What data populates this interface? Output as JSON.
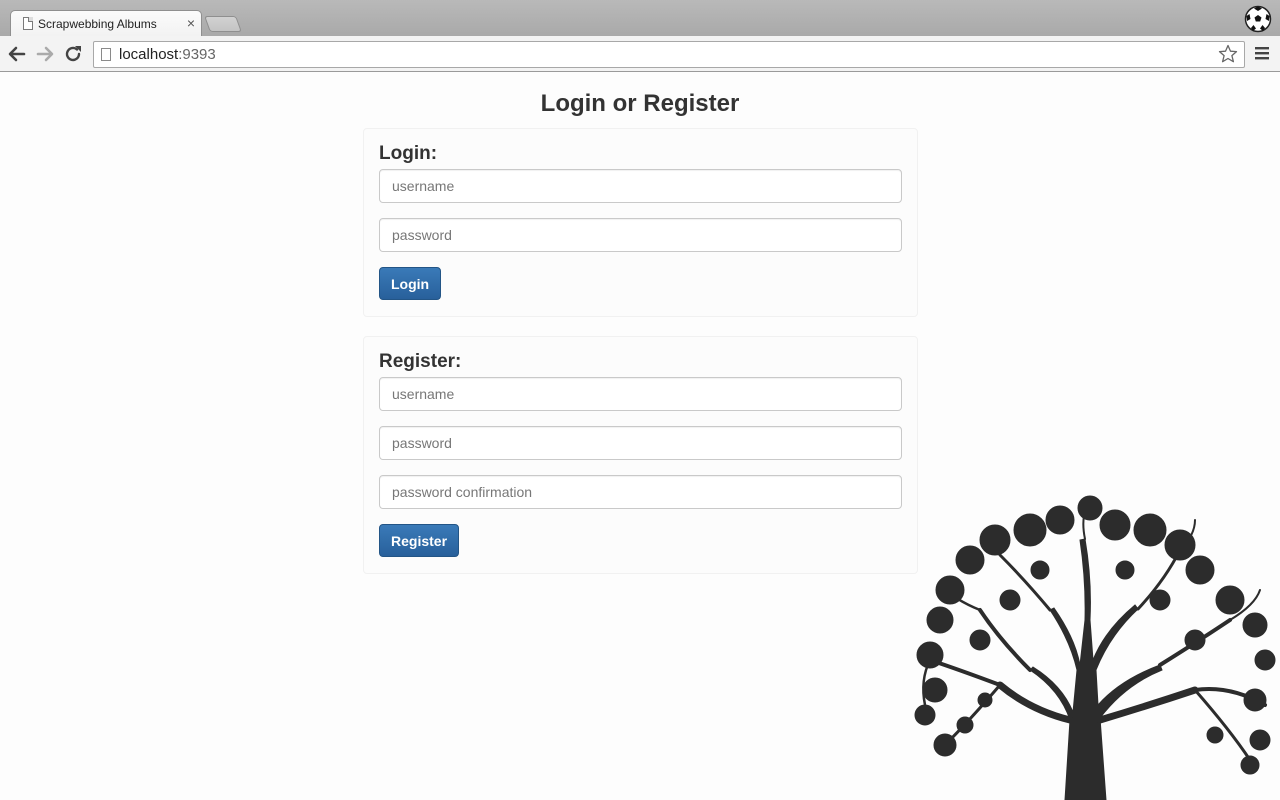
{
  "browser": {
    "tab_title": "Scrapwebbing Albums",
    "tab_close": "×",
    "url_host": "localhost",
    "url_port": ":9393"
  },
  "page": {
    "title": "Login or Register"
  },
  "login": {
    "heading": "Login:",
    "username_placeholder": "username",
    "password_placeholder": "password",
    "button_label": "Login"
  },
  "register": {
    "heading": "Register:",
    "username_placeholder": "username",
    "password_placeholder": "password",
    "confirm_placeholder": "password confirmation",
    "button_label": "Register"
  },
  "colors": {
    "button": "#2d6aa6",
    "tree": "#2c2c2c"
  }
}
